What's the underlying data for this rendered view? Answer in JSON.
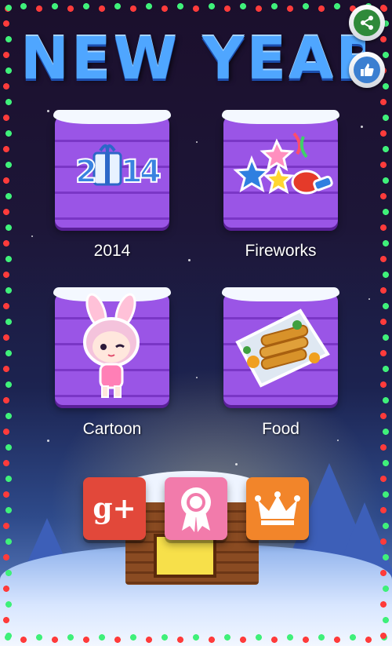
{
  "title": "NEW YEAR",
  "top_actions": {
    "share_icon": "share-icon",
    "like_icon": "thumbs-up-icon"
  },
  "categories": [
    {
      "label": "2014",
      "art": "2014-gift-icon",
      "art_text": "2014"
    },
    {
      "label": "Fireworks",
      "art": "fireworks-stars-icon"
    },
    {
      "label": "Cartoon",
      "art": "bunny-girl-icon"
    },
    {
      "label": "Food",
      "art": "spring-rolls-icon"
    }
  ],
  "bottom_buttons": [
    {
      "name": "google-plus",
      "icon": "google-plus-icon",
      "text": "g+",
      "color": "#e2483a"
    },
    {
      "name": "award",
      "icon": "award-ribbon-icon",
      "color": "#f27bab"
    },
    {
      "name": "crown",
      "icon": "crown-icon",
      "color": "#f2852a"
    }
  ],
  "colors": {
    "tile_purple": "#9a55e6",
    "title_blue": "#4fa6ff"
  }
}
